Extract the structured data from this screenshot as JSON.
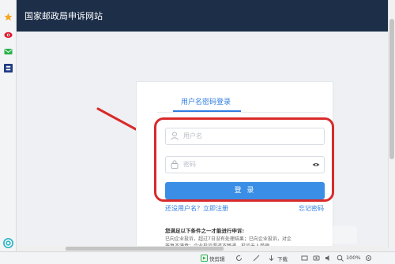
{
  "header": {
    "site_title": "国家邮政局申诉网站"
  },
  "login": {
    "tab_label": "用户名密码登录",
    "username_placeholder": "用户名",
    "password_placeholder": "密码",
    "login_button": "登 录",
    "register_link": "还没用户名？立即注册",
    "forgot_link": "忘记密码"
  },
  "notice": {
    "title": "您满足以下条件之一才能进行申诉:",
    "line1": "已向企业投诉，超过7日没有处理结果；已向企业投诉，对企",
    "line2": "答复不满意；企业投诉渠道不畅通，投诉无人受理。"
  },
  "left_toolbar": {
    "icons": [
      "star-icon",
      "weibo-icon",
      "mail-icon",
      "app-icon",
      "help-icon"
    ]
  },
  "status_bar": {
    "quick_clip": "快剪辑",
    "download": "下载",
    "zoom": "100%"
  },
  "colors": {
    "header_bg": "#1c2e48",
    "accent": "#2f7de1",
    "button": "#3a8ee6",
    "annotation": "#d92a2a"
  }
}
